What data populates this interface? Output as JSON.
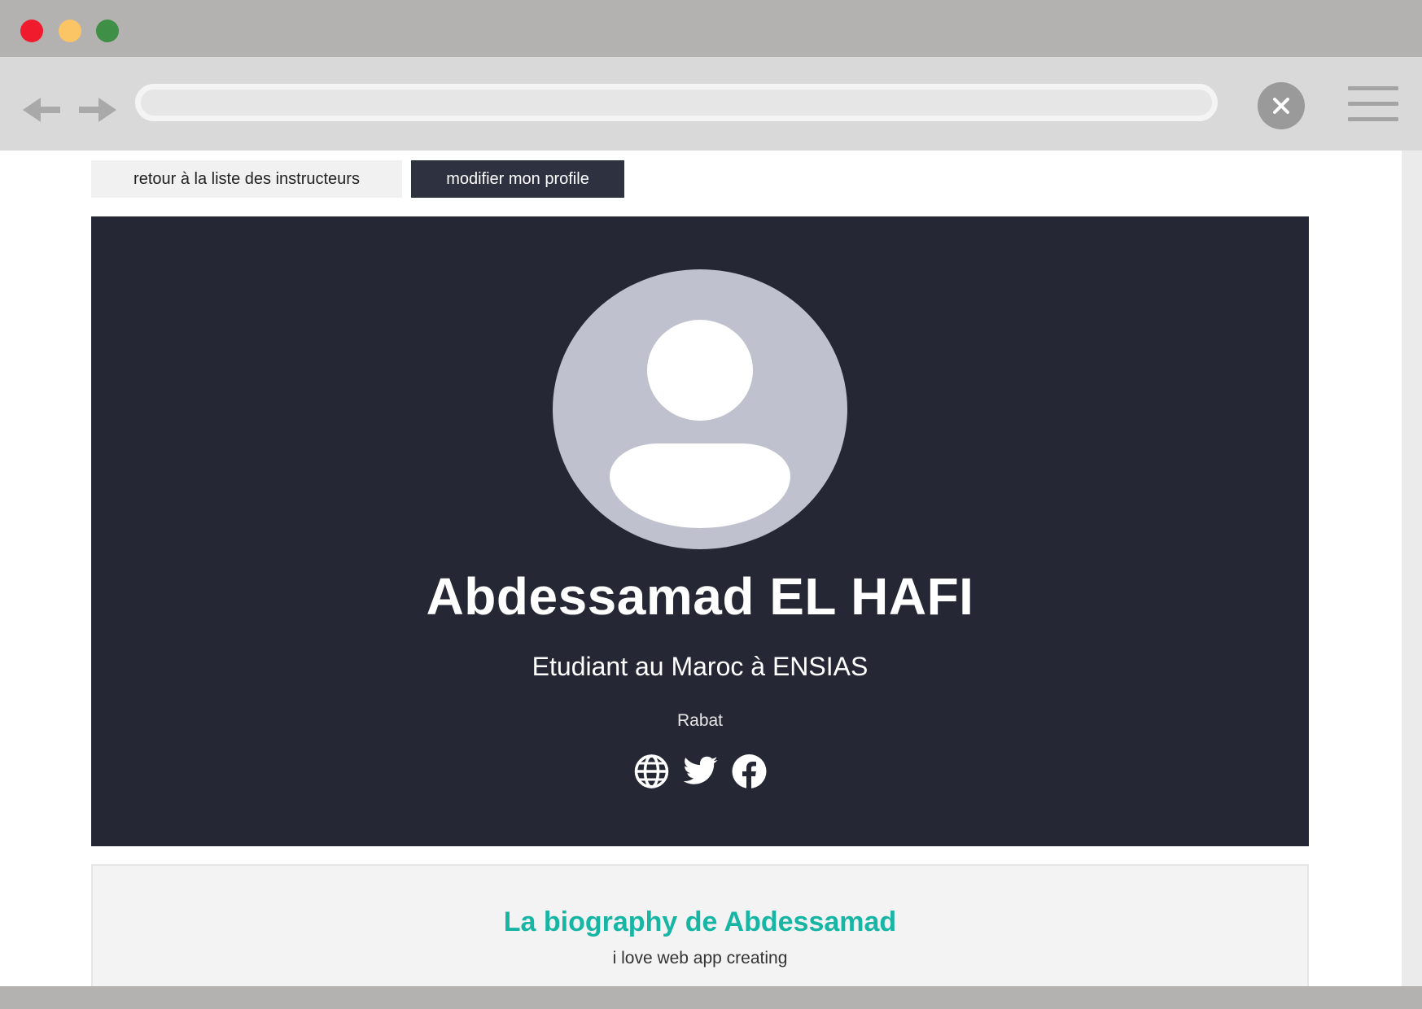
{
  "browser": {
    "url": "",
    "colors": {
      "close_dot": "#f01c2e",
      "minimize_dot": "#fbc464",
      "maximize_dot": "#3f8f46"
    }
  },
  "actions": {
    "back_label": "retour à la liste des instructeurs",
    "edit_label": "modifier mon profile"
  },
  "profile": {
    "name": "Abdessamad EL HAFI",
    "tagline": "Etudiant au Maroc à ENSIAS",
    "city": "Rabat",
    "social_icons": [
      "globe-icon",
      "twitter-icon",
      "facebook-icon"
    ]
  },
  "bio": {
    "title": "La biography de Abdessamad",
    "text": "i love web app creating"
  },
  "colors": {
    "hero_bg": "#252734",
    "edit_button_bg": "#2d3140",
    "bio_title": "#17b5a4"
  }
}
